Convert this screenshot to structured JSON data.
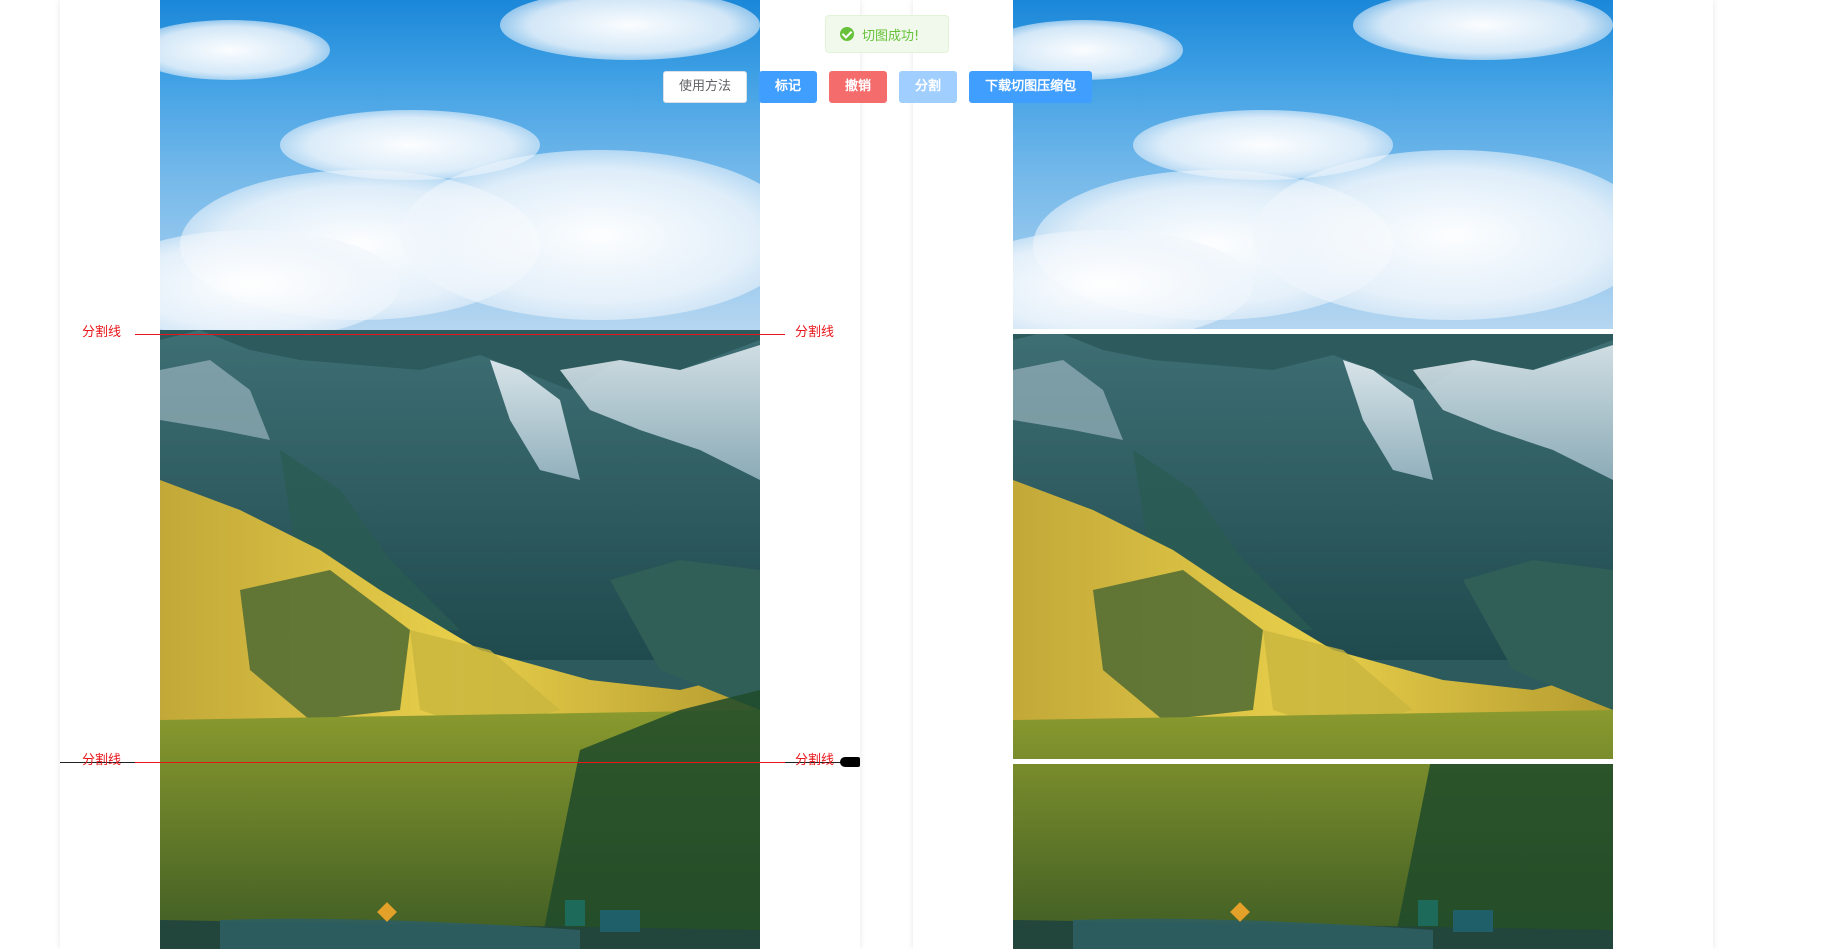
{
  "toast": {
    "message": "切图成功!",
    "icon": "check-circle-icon",
    "color": "#67c23a"
  },
  "toolbar": {
    "usage_label": "使用方法",
    "mark_label": "标记",
    "undo_label": "撤销",
    "split_label": "分割",
    "download_label": "下载切图压缩包"
  },
  "dividers": [
    {
      "left_label": "分割线",
      "right_label": "分割线"
    },
    {
      "left_label": "分割线",
      "right_label": "分割线"
    }
  ],
  "colors": {
    "primary": "#409eff",
    "danger": "#f56c6c",
    "primary_disabled": "#a0cfff",
    "divider": "#e8161b",
    "success": "#67c23a"
  }
}
